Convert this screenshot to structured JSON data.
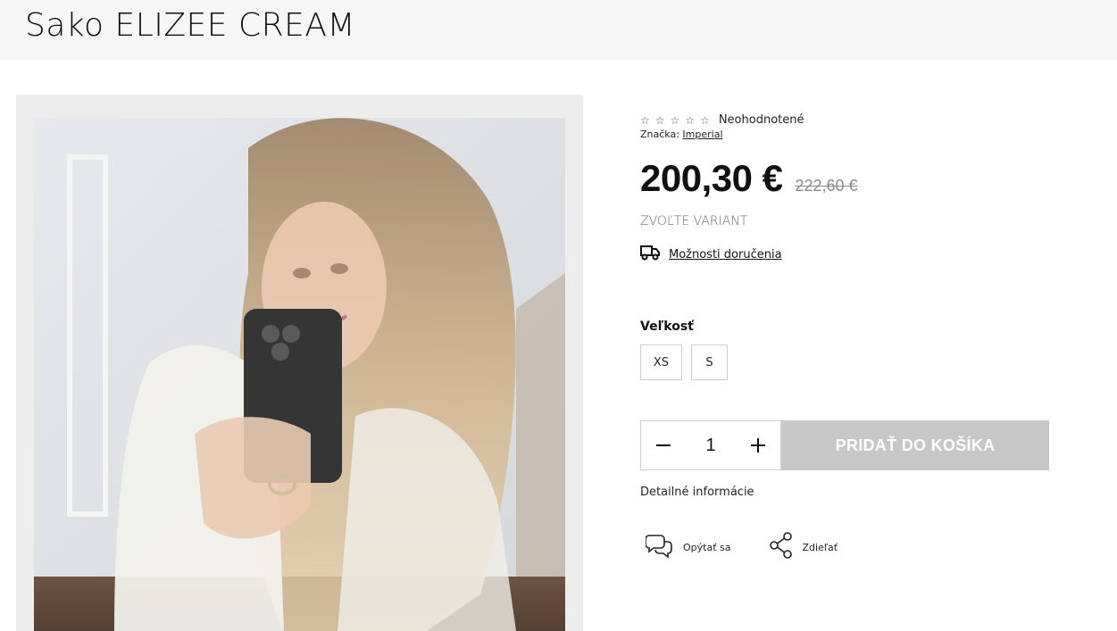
{
  "product": {
    "title": "Sako ELIZEE CREAM",
    "image_alt": "product-photo"
  },
  "rating": {
    "stars": [
      "☆",
      "☆",
      "☆",
      "☆",
      "☆"
    ],
    "value": 0,
    "label": "Neohodnotené"
  },
  "brand": {
    "prefix": "Značka:",
    "name": "Imperial"
  },
  "price": {
    "current": "200,30 €",
    "original": "222,60 €"
  },
  "variant_prompt": "ZVOĽTE VARIANT",
  "delivery": {
    "icon": "truck-icon",
    "label": "Možnosti doručenia"
  },
  "size": {
    "label": "Veľkosť",
    "options": [
      "XS",
      "S"
    ]
  },
  "cart": {
    "quantity": "1",
    "decrease_icon": "minus-icon",
    "increase_icon": "plus-icon",
    "add_label": "PRIDAŤ DO KOŠÍKA",
    "button_color": "#c7c7c7"
  },
  "details_label": "Detailné informácie",
  "actions": {
    "ask": {
      "icon": "chat-bubbles-icon",
      "label": "Opýtať sa"
    },
    "share": {
      "icon": "share-icon",
      "label": "Zdieľať"
    }
  }
}
